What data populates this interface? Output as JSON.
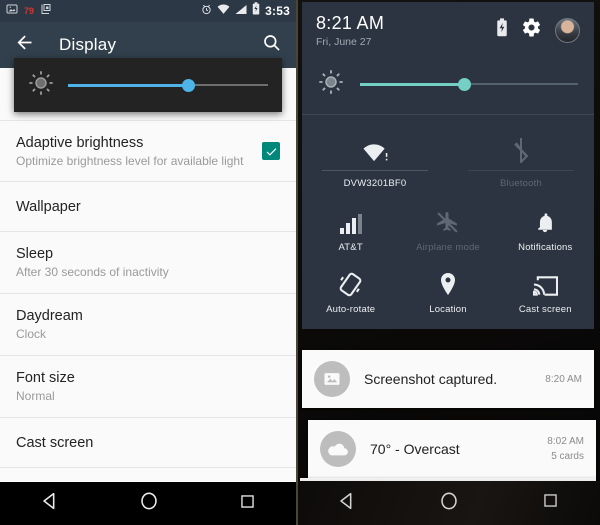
{
  "left_panel": {
    "status_bar": {
      "icons": [
        "image-icon",
        "photo-count-badge",
        "library-icon",
        "alarm-icon",
        "wifi-icon",
        "signal-icon",
        "battery-charging-icon"
      ],
      "photo_badge": "79",
      "clock": "3:53"
    },
    "app_bar": {
      "back_label": "back-arrow",
      "title": "Display",
      "search_label": "search"
    },
    "brightness_overlay": {
      "icon": "brightness-sun-icon",
      "value_percent": 60,
      "accent": "#4eb4e8"
    },
    "settings_rows": [
      {
        "title": "Adaptive brightness",
        "sub": "Optimize brightness level for available light",
        "checkbox": true,
        "checkbox_color": "#00897b"
      },
      {
        "title": "Wallpaper",
        "sub": "",
        "checkbox": false
      },
      {
        "title": "Sleep",
        "sub": "After 30 seconds of inactivity",
        "checkbox": false
      },
      {
        "title": "Daydream",
        "sub": "Clock",
        "checkbox": false
      },
      {
        "title": "Font size",
        "sub": "Normal",
        "checkbox": false
      },
      {
        "title": "Cast screen",
        "sub": "",
        "checkbox": false
      }
    ],
    "nav_bar": {
      "back": "back-triangle",
      "home": "home-circle",
      "recents": "recents-square"
    }
  },
  "right_panel": {
    "quick_settings": {
      "time": "8:21 AM",
      "date": "Fri, June 27",
      "battery_icon": "battery-charging-icon",
      "settings_icon": "gear-icon",
      "avatar": "user-avatar",
      "brightness": {
        "icon": "brightness-sun-icon",
        "value_percent": 48,
        "accent": "#74cfc4"
      },
      "tiles": [
        [
          {
            "label": "DVW3201BF0",
            "icon": "wifi-icon",
            "state": "on"
          },
          {
            "label": "Bluetooth",
            "icon": "bluetooth-disabled-icon",
            "state": "off"
          }
        ],
        [
          {
            "label": "AT&T",
            "icon": "cell-signal-icon",
            "state": "on"
          },
          {
            "label": "Airplane mode",
            "icon": "airplane-off-icon",
            "state": "off"
          },
          {
            "label": "Notifications",
            "icon": "bell-icon",
            "state": "on"
          }
        ],
        [
          {
            "label": "Auto-rotate",
            "icon": "auto-rotate-icon",
            "state": "on"
          },
          {
            "label": "Location",
            "icon": "location-pin-icon",
            "state": "on"
          },
          {
            "label": "Cast screen",
            "icon": "cast-screen-icon",
            "state": "on"
          }
        ]
      ]
    },
    "notifications": [
      {
        "icon": "image-icon",
        "text": "Screenshot captured.",
        "time": "8:20 AM",
        "extra": ""
      },
      {
        "icon": "cloud-icon",
        "text": "70° - Overcast",
        "time": "8:02 AM",
        "extra": "5 cards"
      }
    ],
    "nav_bar": {
      "back": "back-triangle",
      "home": "home-circle",
      "recents": "recents-square"
    }
  },
  "theme": {
    "status_bar_bg": "#2c3845",
    "app_bar_bg": "#32404d",
    "shade_bg": "#2b3440",
    "list_bg": "#fafafa",
    "accent_teal": "#00897b",
    "accent_blue": "#4eb4e8"
  }
}
